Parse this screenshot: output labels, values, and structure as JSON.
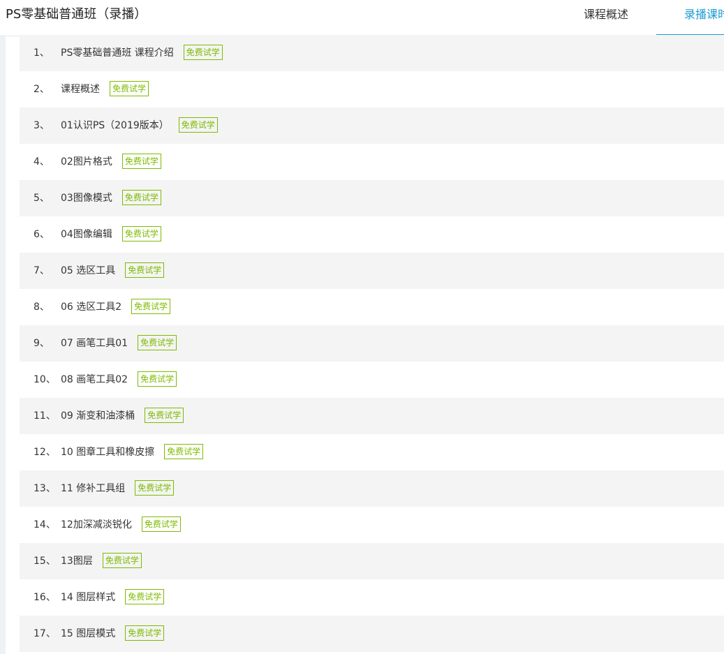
{
  "header": {
    "course_title": "PS零基础普通班（录播）",
    "tabs": [
      {
        "label": "课程概述"
      },
      {
        "label": "录播课时"
      }
    ]
  },
  "colors": {
    "accent": "#1b9ad6",
    "badge": "#7dbb00",
    "row_alt": "#f4f4f4"
  },
  "lessons": [
    {
      "index": "1、",
      "title": "PS零基础普通班 课程介绍",
      "badge": "免费试学"
    },
    {
      "index": "2、",
      "title": "课程概述",
      "badge": "免费试学"
    },
    {
      "index": "3、",
      "title": "01认识PS（2019版本）",
      "badge": "免费试学"
    },
    {
      "index": "4、",
      "title": "02图片格式",
      "badge": "免费试学"
    },
    {
      "index": "5、",
      "title": "03图像模式",
      "badge": "免费试学"
    },
    {
      "index": "6、",
      "title": "04图像编辑",
      "badge": "免费试学"
    },
    {
      "index": "7、",
      "title": "05 选区工具",
      "badge": "免费试学"
    },
    {
      "index": "8、",
      "title": "06 选区工具2",
      "badge": "免费试学"
    },
    {
      "index": "9、",
      "title": "07 画笔工具01",
      "badge": "免费试学"
    },
    {
      "index": "10、",
      "title": "08 画笔工具02",
      "badge": "免费试学"
    },
    {
      "index": "11、",
      "title": "09 渐变和油漆桶",
      "badge": "免费试学"
    },
    {
      "index": "12、",
      "title": "10 图章工具和橡皮擦",
      "badge": "免费试学"
    },
    {
      "index": "13、",
      "title": "11 修补工具组",
      "badge": "免费试学"
    },
    {
      "index": "14、",
      "title": "12加深减淡锐化",
      "badge": "免费试学"
    },
    {
      "index": "15、",
      "title": "13图层",
      "badge": "免费试学"
    },
    {
      "index": "16、",
      "title": "14 图层样式",
      "badge": "免费试学"
    },
    {
      "index": "17、",
      "title": "15 图层模式",
      "badge": "免费试学"
    }
  ]
}
